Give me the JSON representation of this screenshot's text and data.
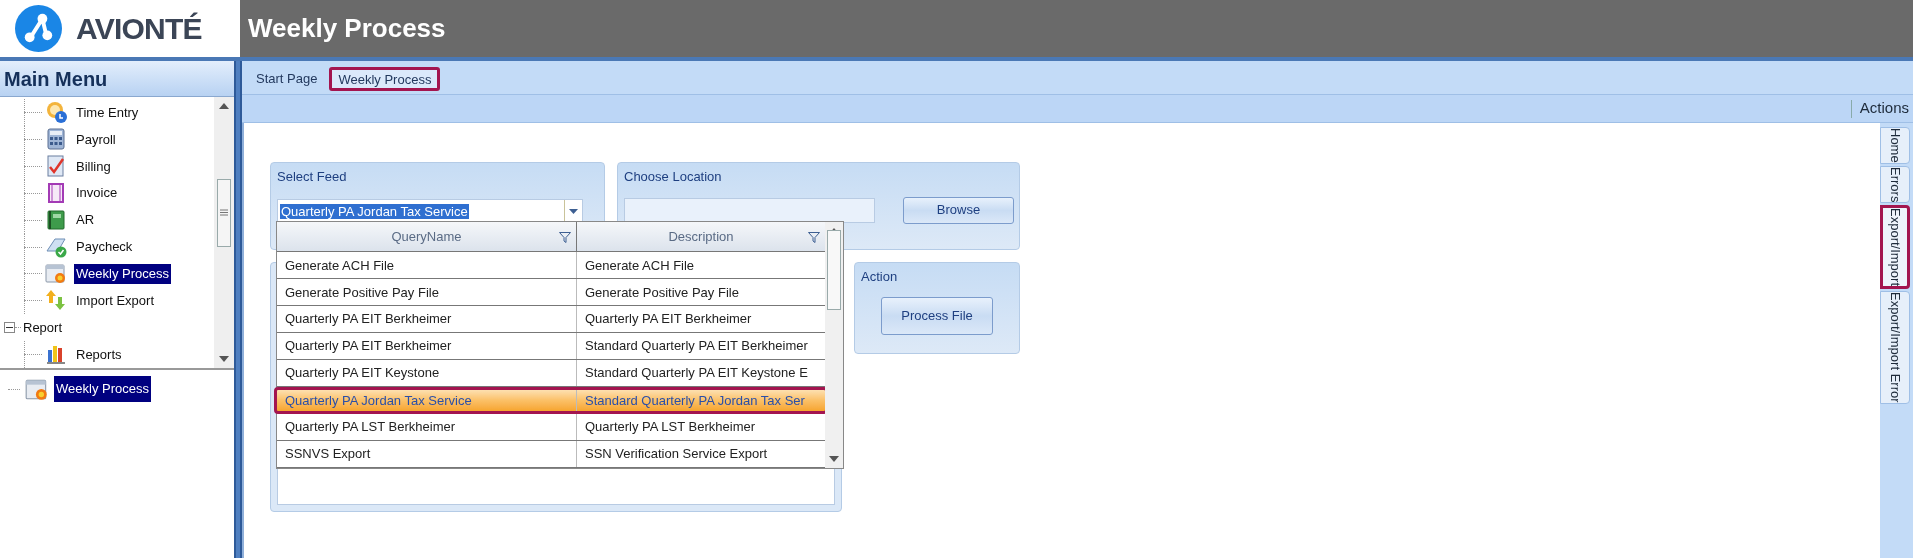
{
  "header": {
    "logo_text": "AVIONTÉ",
    "title": "Weekly Process"
  },
  "main_menu": {
    "title": "Main Menu",
    "items": [
      {
        "label": "Time Entry",
        "selected": false
      },
      {
        "label": "Payroll",
        "selected": false
      },
      {
        "label": "Billing",
        "selected": false
      },
      {
        "label": "Invoice",
        "selected": false
      },
      {
        "label": "AR",
        "selected": false
      },
      {
        "label": "Paycheck",
        "selected": false
      },
      {
        "label": "Weekly Process",
        "selected": true
      },
      {
        "label": "Import Export",
        "selected": false
      },
      {
        "label": "Report",
        "selected": false,
        "expanded": true,
        "children": [
          {
            "label": "Reports",
            "selected": false
          }
        ]
      }
    ]
  },
  "open_windows": [
    {
      "label": "Weekly Process",
      "selected": true
    }
  ],
  "tabs": [
    {
      "label": "Start Page",
      "selected": false
    },
    {
      "label": "Weekly Process",
      "selected": true
    }
  ],
  "toolbar": {
    "actions_label": "Actions"
  },
  "side_tabs": [
    {
      "label": "Home",
      "selected": false
    },
    {
      "label": "Errors",
      "selected": false
    },
    {
      "label": "Export/Import",
      "selected": true
    },
    {
      "label": "Export/Import Error",
      "selected": false
    }
  ],
  "select_feed": {
    "title": "Select Feed",
    "value": "Quarterly PA Jordan Tax Service",
    "dropdown": {
      "columns": [
        "QueryName",
        "Description"
      ],
      "rows": [
        {
          "cells": [
            "Generate ACH File",
            "Generate ACH File"
          ],
          "selected": false
        },
        {
          "cells": [
            "Generate Positive Pay File",
            "Generate Positive Pay File"
          ],
          "selected": false
        },
        {
          "cells": [
            "Quarterly PA EIT Berkheimer",
            "Quarterly PA EIT Berkheimer"
          ],
          "selected": false
        },
        {
          "cells": [
            "Quarterly PA EIT Berkheimer",
            "Standard Quarterly PA EIT Berkheimer"
          ],
          "selected": false
        },
        {
          "cells": [
            "Quarterly PA EIT Keystone",
            "Standard Quarterly PA EIT Keystone E"
          ],
          "selected": false
        },
        {
          "cells": [
            "Quarterly PA Jordan Tax Service",
            "Standard Quarterly PA Jordan Tax Ser"
          ],
          "selected": true
        },
        {
          "cells": [
            "Quarterly PA LST Berkheimer",
            "Quarterly PA LST Berkheimer"
          ],
          "selected": false
        },
        {
          "cells": [
            "SSNVS Export",
            "SSN Verification Service Export"
          ],
          "selected": false
        }
      ]
    }
  },
  "choose_location": {
    "title": "Choose Location",
    "button": "Browse"
  },
  "action": {
    "title": "Action",
    "button": "Process File"
  }
}
